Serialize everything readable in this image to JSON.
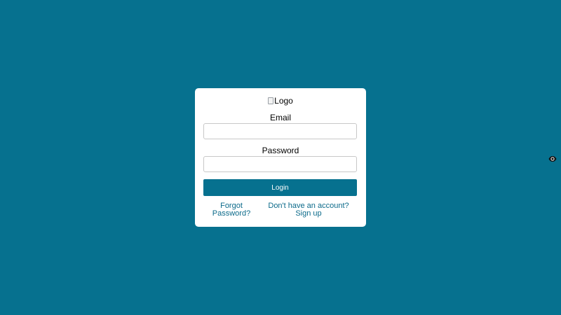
{
  "logo": {
    "alt_text": "Logo"
  },
  "form": {
    "email_label": "Email",
    "email_value": "",
    "password_label": "Password",
    "password_value": "",
    "login_label": "Login",
    "forgot_password_label": "Forgot Password?",
    "signup_label": "Don't have an account? Sign up"
  },
  "icons": {
    "password_toggle": "eye-icon"
  },
  "colors": {
    "background": "#06718f",
    "accent": "#06718f",
    "link": "#0b6a8a",
    "card": "#ffffff"
  }
}
